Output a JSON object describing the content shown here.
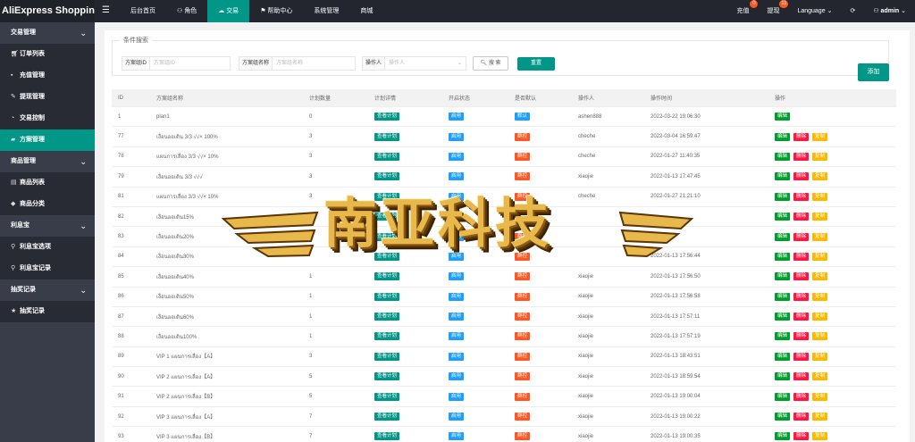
{
  "app": {
    "title": "AliExpress Shopping..."
  },
  "sidebar": {
    "groups": [
      {
        "label": "交易管理",
        "items": [
          {
            "label": "订单列表",
            "icon": "cart-icon"
          },
          {
            "label": "充值管理",
            "icon": "chat-icon"
          },
          {
            "label": "提现管理",
            "icon": "wrench-icon"
          },
          {
            "label": "交易控制",
            "icon": "gauge-icon"
          },
          {
            "label": "方案管理",
            "icon": "folder-icon",
            "active": true
          }
        ]
      },
      {
        "label": "商品管理",
        "items": [
          {
            "label": "商品列表",
            "icon": "list-icon"
          },
          {
            "label": "商品分类",
            "icon": "tag-icon"
          }
        ]
      },
      {
        "label": "利息宝",
        "items": [
          {
            "label": "利息宝选项",
            "icon": "link-icon"
          },
          {
            "label": "利息宝记录",
            "icon": "link-icon"
          }
        ]
      },
      {
        "label": "抽奖记录",
        "items": [
          {
            "label": "抽奖记录",
            "icon": "star-icon"
          }
        ]
      }
    ]
  },
  "topbar": {
    "nav": [
      {
        "label": "后台首页",
        "icon": ""
      },
      {
        "label": "角色",
        "icon": "user-icon"
      },
      {
        "label": "交易",
        "icon": "cloud-icon",
        "active": true
      },
      {
        "label": "帮助中心",
        "icon": "flag-icon"
      },
      {
        "label": "系统管理",
        "icon": ""
      },
      {
        "label": "商城",
        "icon": ""
      }
    ],
    "recharge": {
      "label": "充值",
      "badge": "0"
    },
    "withdraw": {
      "label": "提现",
      "badge": "11"
    },
    "language": "Language",
    "user": "admin"
  },
  "search": {
    "legend": "条件搜索",
    "group_id_label": "方案组ID",
    "group_id_placeholder": "方案组ID",
    "group_name_label": "方案组名称",
    "group_name_placeholder": "方案组名称",
    "operator_label": "操作人",
    "operator_placeholder": "操作人",
    "search_button": "搜 索",
    "reset_button": "重置",
    "add_button": "添加"
  },
  "table": {
    "headers": [
      "ID",
      "方案组名称",
      "计划数量",
      "计划详情",
      "开启状态",
      "是否默认",
      "操作人",
      "操作时间",
      "操作"
    ],
    "detail_label": "查看计划",
    "status_label": "启用",
    "default_yes": "默认",
    "default_no": "群控",
    "edit_label": "编辑",
    "delete_label": "删除",
    "copy_label": "复制",
    "rows": [
      {
        "id": "1",
        "name": "plan1",
        "count": "0",
        "default": "默认",
        "operator": "ashen888",
        "time": "2022-03-22 19:06:30",
        "actions": [
          "编辑"
        ]
      },
      {
        "id": "77",
        "name": "เงื่อนออเดิน 3/3 √√× 100%",
        "count": "3",
        "default": "群控",
        "operator": "cheche",
        "time": "2022-03-04 16:59:47",
        "actions": [
          "编辑",
          "删除",
          "复制"
        ]
      },
      {
        "id": "78",
        "name": "แผนการเลื่อง 3/3 √√× 10%",
        "count": "3",
        "default": "群控",
        "operator": "cheche",
        "time": "2022-01-27 11:40:35",
        "actions": [
          "编辑",
          "删除",
          "复制"
        ]
      },
      {
        "id": "79",
        "name": "เงื่อนออเดิน 3/3 √√√",
        "count": "3",
        "default": "群控",
        "operator": "xiaojie",
        "time": "2022-01-13 17:47:45",
        "actions": [
          "编辑",
          "删除",
          "复制"
        ]
      },
      {
        "id": "81",
        "name": "แผนการเลื่อง 3/3 √√× 10%",
        "count": "3",
        "default": "群控",
        "operator": "cheche",
        "time": "2022-01-27 21:21:10",
        "actions": [
          "编辑",
          "删除",
          "复制"
        ]
      },
      {
        "id": "82",
        "name": "เงื่อนออเดิน15%",
        "count": "",
        "default": "群控",
        "operator": "",
        "time": "",
        "actions": [
          "编辑",
          "删除",
          "复制"
        ]
      },
      {
        "id": "83",
        "name": "เงื่อนออเดิน20%",
        "count": "",
        "default": "群控",
        "operator": "",
        "time": "",
        "actions": [
          "编辑",
          "删除",
          "复制"
        ]
      },
      {
        "id": "84",
        "name": "เงื่อนออเดิน30%",
        "count": "",
        "default": "群控",
        "operator": "",
        "time": "2022-01-13 17:56:44",
        "actions": [
          "编辑",
          "删除",
          "复制"
        ]
      },
      {
        "id": "85",
        "name": "เงื่อนออเดิน40%",
        "count": "1",
        "default": "群控",
        "operator": "xiaojie",
        "time": "2022-01-13 17:56:50",
        "actions": [
          "编辑",
          "删除",
          "复制"
        ]
      },
      {
        "id": "86",
        "name": "เงื่อนออเดิน50%",
        "count": "1",
        "default": "群控",
        "operator": "xiaojie",
        "time": "2022-01-13 17:56:58",
        "actions": [
          "编辑",
          "删除",
          "复制"
        ]
      },
      {
        "id": "87",
        "name": "เงื่อนออเดิน60%",
        "count": "1",
        "default": "群控",
        "operator": "xiaojie",
        "time": "2022-01-13 17:57:11",
        "actions": [
          "编辑",
          "删除",
          "复制"
        ]
      },
      {
        "id": "88",
        "name": "เงื่อนออเดิน100%",
        "count": "1",
        "default": "群控",
        "operator": "xiaojie",
        "time": "2022-01-13 17:57:19",
        "actions": [
          "编辑",
          "删除",
          "复制"
        ]
      },
      {
        "id": "89",
        "name": "VIP 1 แผนการเลื่อง【A】",
        "count": "3",
        "default": "群控",
        "operator": "xiaojie",
        "time": "2022-01-13 18:43:51",
        "actions": [
          "编辑",
          "删除",
          "复制"
        ]
      },
      {
        "id": "90",
        "name": "VIP 2 แผนการเลื่อง【A】",
        "count": "5",
        "default": "群控",
        "operator": "xiaojie",
        "time": "2022-01-13 18:59:54",
        "actions": [
          "编辑",
          "删除",
          "复制"
        ]
      },
      {
        "id": "91",
        "name": "VIP 2 แผนการเลื่อง【B】",
        "count": "5",
        "default": "群控",
        "operator": "xiaojie",
        "time": "2022-01-13 19:00:04",
        "actions": [
          "编辑",
          "删除",
          "复制"
        ]
      },
      {
        "id": "92",
        "name": "VIP 3 แผนการเลื่อง【A】",
        "count": "7",
        "default": "群控",
        "operator": "xiaojie",
        "time": "2022-01-13 19:00:22",
        "actions": [
          "编辑",
          "删除",
          "复制"
        ]
      },
      {
        "id": "93",
        "name": "VIP 3 แผนการเลื่อง【B】",
        "count": "7",
        "default": "群控",
        "operator": "xiaojie",
        "time": "2022-01-13 19:00:35",
        "actions": [
          "编辑",
          "删除",
          "复制"
        ]
      }
    ]
  },
  "watermark": {
    "text": "南亚科技"
  },
  "colors": {
    "accent": "#009688",
    "sidebar": "#393d49",
    "topbar": "#23262e",
    "tag_blue": "#1e9fff",
    "tag_orange": "#ff5722",
    "tag_green": "#009f2b",
    "tag_red": "#ff1744",
    "tag_yellow": "#ffb800"
  }
}
